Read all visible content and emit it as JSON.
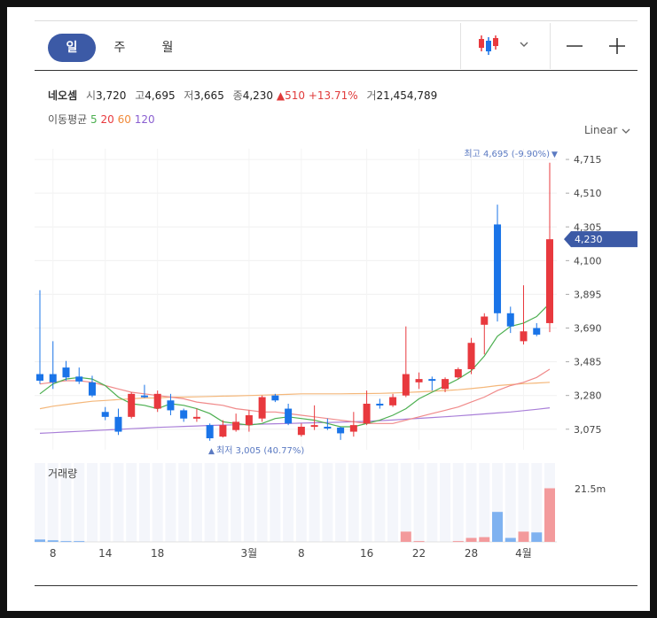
{
  "tabs": [
    "일",
    "주",
    "월"
  ],
  "active_tab": 0,
  "summary": {
    "name": "네오셈",
    "open_label": "시",
    "open": "3,720",
    "high_label": "고",
    "high": "4,695",
    "low_label": "저",
    "low": "3,665",
    "close_label": "종",
    "close": "4,230",
    "change": "510",
    "change_pct": "+13.71%",
    "volume_label": "거",
    "volume": "21,454,789"
  },
  "ma_legend": {
    "label": "이동평균",
    "periods": [
      "5",
      "20",
      "60",
      "120"
    ]
  },
  "colors": {
    "up": "#e8393e",
    "down": "#1a74e8",
    "ma5": "#4caf50",
    "ma20": "#f08a8a",
    "ma60": "#f4b77a",
    "ma120": "#a97fd8",
    "accent": "#3c5aa6",
    "price_tag": "#3c5aa6"
  },
  "scale": "Linear",
  "high_annotation": "최고 4,695 (-9.90%)",
  "low_annotation": "최저 3,005 (40.77%)",
  "volume_label": "거래량",
  "volume_tick": "21.5m",
  "current_price_label": "4,230",
  "chart_data": {
    "type": "candlestick",
    "y_ticks": [
      4715,
      4510,
      4305,
      4100,
      3895,
      3690,
      3485,
      3280,
      3075
    ],
    "y_tick_labels": [
      "4,715",
      "4,510",
      "4,305",
      "4,100",
      "3,895",
      "3,690",
      "3,485",
      "3,280",
      "3,075"
    ],
    "ylim": [
      2950,
      4780
    ],
    "x_tick_labels": [
      {
        "label": "8",
        "index": 1
      },
      {
        "label": "14",
        "index": 5
      },
      {
        "label": "18",
        "index": 9
      },
      {
        "label": "3월",
        "index": 16
      },
      {
        "label": "8",
        "index": 20
      },
      {
        "label": "16",
        "index": 25
      },
      {
        "label": "22",
        "index": 29
      },
      {
        "label": "28",
        "index": 33
      },
      {
        "label": "4월",
        "index": 37
      }
    ],
    "candles": [
      {
        "o": 3410,
        "h": 3920,
        "l": 3350,
        "c": 3370
      },
      {
        "o": 3410,
        "h": 3610,
        "l": 3320,
        "c": 3360
      },
      {
        "o": 3450,
        "h": 3490,
        "l": 3370,
        "c": 3390
      },
      {
        "o": 3395,
        "h": 3450,
        "l": 3350,
        "c": 3365
      },
      {
        "o": 3360,
        "h": 3400,
        "l": 3270,
        "c": 3280
      },
      {
        "o": 3180,
        "h": 3210,
        "l": 3130,
        "c": 3150
      },
      {
        "o": 3150,
        "h": 3200,
        "l": 3040,
        "c": 3060
      },
      {
        "o": 3150,
        "h": 3300,
        "l": 3140,
        "c": 3290
      },
      {
        "o": 3280,
        "h": 3345,
        "l": 3265,
        "c": 3270
      },
      {
        "o": 3200,
        "h": 3310,
        "l": 3180,
        "c": 3290
      },
      {
        "o": 3250,
        "h": 3290,
        "l": 3160,
        "c": 3190
      },
      {
        "o": 3190,
        "h": 3200,
        "l": 3120,
        "c": 3140
      },
      {
        "o": 3140,
        "h": 3200,
        "l": 3120,
        "c": 3150
      },
      {
        "o": 3100,
        "h": 3110,
        "l": 3005,
        "c": 3020
      },
      {
        "o": 3030,
        "h": 3130,
        "l": 3025,
        "c": 3100
      },
      {
        "o": 3070,
        "h": 3170,
        "l": 3060,
        "c": 3120
      },
      {
        "o": 3100,
        "h": 3190,
        "l": 3060,
        "c": 3160
      },
      {
        "o": 3140,
        "h": 3280,
        "l": 3120,
        "c": 3270
      },
      {
        "o": 3280,
        "h": 3290,
        "l": 3240,
        "c": 3250
      },
      {
        "o": 3200,
        "h": 3230,
        "l": 3100,
        "c": 3110
      },
      {
        "o": 3040,
        "h": 3110,
        "l": 3030,
        "c": 3090
      },
      {
        "o": 3090,
        "h": 3220,
        "l": 3070,
        "c": 3100
      },
      {
        "o": 3090,
        "h": 3140,
        "l": 3070,
        "c": 3080
      },
      {
        "o": 3085,
        "h": 3090,
        "l": 3010,
        "c": 3050
      },
      {
        "o": 3060,
        "h": 3180,
        "l": 3030,
        "c": 3100
      },
      {
        "o": 3110,
        "h": 3310,
        "l": 3100,
        "c": 3230
      },
      {
        "o": 3230,
        "h": 3260,
        "l": 3200,
        "c": 3220
      },
      {
        "o": 3220,
        "h": 3290,
        "l": 3210,
        "c": 3270
      },
      {
        "o": 3280,
        "h": 3700,
        "l": 3270,
        "c": 3410
      },
      {
        "o": 3360,
        "h": 3420,
        "l": 3320,
        "c": 3380
      },
      {
        "o": 3380,
        "h": 3395,
        "l": 3310,
        "c": 3370
      },
      {
        "o": 3320,
        "h": 3390,
        "l": 3300,
        "c": 3380
      },
      {
        "o": 3390,
        "h": 3450,
        "l": 3380,
        "c": 3440
      },
      {
        "o": 3440,
        "h": 3630,
        "l": 3410,
        "c": 3600
      },
      {
        "o": 3710,
        "h": 3780,
        "l": 3530,
        "c": 3760
      },
      {
        "o": 4320,
        "h": 4440,
        "l": 3730,
        "c": 3780
      },
      {
        "o": 3780,
        "h": 3820,
        "l": 3660,
        "c": 3700
      },
      {
        "o": 3610,
        "h": 3950,
        "l": 3590,
        "c": 3670
      },
      {
        "o": 3690,
        "h": 3720,
        "l": 3640,
        "c": 3650
      },
      {
        "o": 3720,
        "h": 4695,
        "l": 3665,
        "c": 4230
      }
    ],
    "volume": [
      0.03,
      0.02,
      0.01,
      0.01,
      0,
      0,
      0,
      0,
      0,
      0,
      0,
      0,
      0,
      0,
      0,
      0,
      0,
      0,
      0,
      0,
      0,
      0,
      0,
      0,
      0,
      0,
      0,
      0,
      0.13,
      0.01,
      0,
      0,
      0.01,
      0.05,
      0.06,
      0.38,
      0.05,
      0.13,
      0.12,
      0.68
    ],
    "volume_scale_max": 21.5,
    "volume_unit": "m",
    "ma5": [
      3290,
      3350,
      3380,
      3390,
      3380,
      3340,
      3270,
      3230,
      3220,
      3200,
      3230,
      3220,
      3200,
      3170,
      3120,
      3110,
      3100,
      3110,
      3140,
      3150,
      3140,
      3130,
      3110,
      3090,
      3090,
      3110,
      3130,
      3160,
      3200,
      3260,
      3300,
      3340,
      3380,
      3430,
      3520,
      3640,
      3700,
      3720,
      3760,
      3840
    ],
    "ma20": [
      3350,
      3360,
      3370,
      3370,
      3360,
      3340,
      3320,
      3300,
      3290,
      3280,
      3270,
      3260,
      3240,
      3230,
      3220,
      3200,
      3190,
      3180,
      3180,
      3170,
      3160,
      3150,
      3140,
      3130,
      3120,
      3110,
      3110,
      3110,
      3130,
      3150,
      3170,
      3190,
      3210,
      3240,
      3270,
      3310,
      3340,
      3360,
      3390,
      3440
    ],
    "ma60": [
      3200,
      3215,
      3225,
      3235,
      3245,
      3250,
      3255,
      3260,
      3265,
      3265,
      3270,
      3270,
      3272,
      3274,
      3276,
      3278,
      3280,
      3282,
      3285,
      3287,
      3290,
      3290,
      3290,
      3290,
      3291,
      3292,
      3293,
      3295,
      3298,
      3302,
      3306,
      3310,
      3315,
      3322,
      3330,
      3340,
      3346,
      3352,
      3356,
      3360
    ],
    "ma120": [
      3050,
      3054,
      3058,
      3062,
      3066,
      3070,
      3074,
      3078,
      3082,
      3086,
      3089,
      3092,
      3095,
      3098,
      3100,
      3102,
      3104,
      3106,
      3108,
      3110,
      3112,
      3114,
      3116,
      3118,
      3120,
      3123,
      3127,
      3131,
      3136,
      3141,
      3146,
      3151,
      3156,
      3162,
      3168,
      3174,
      3180,
      3188,
      3196,
      3205
    ]
  }
}
